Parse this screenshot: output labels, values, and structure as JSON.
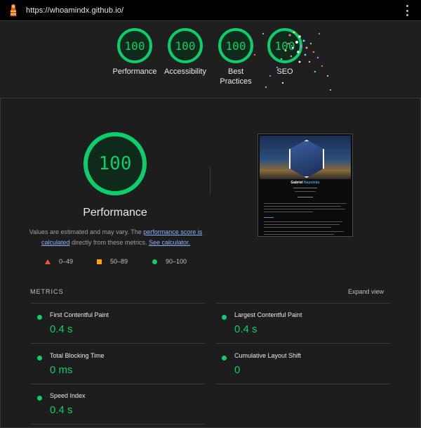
{
  "topbar": {
    "url": "https://whoamindx.github.io/",
    "logo_icon": "lighthouse-icon",
    "menu_icon": "kebab-menu-icon"
  },
  "summary": {
    "gauges": [
      {
        "label": "Performance",
        "score": "100"
      },
      {
        "label": "Accessibility",
        "score": "100"
      },
      {
        "label": "Best Practices",
        "score": "100"
      },
      {
        "label": "SEO",
        "score": "100"
      }
    ]
  },
  "performance": {
    "score": "100",
    "title": "Performance",
    "note_prefix": "Values are estimated and may vary. The ",
    "note_link1": "performance score is calculated",
    "note_middle": " directly from these metrics. ",
    "note_link2": "See calculator.",
    "legend": [
      {
        "range": "0–49",
        "icon": "fail-triangle-icon"
      },
      {
        "range": "50–89",
        "icon": "average-square-icon"
      },
      {
        "range": "90–100",
        "icon": "pass-circle-icon"
      }
    ]
  },
  "thumbnail": {
    "first_name": "Gabriel",
    "last_name": "Napoleão"
  },
  "metrics": {
    "title": "METRICS",
    "expand_label": "Expand view",
    "items": [
      {
        "label": "First Contentful Paint",
        "value": "0.4 s"
      },
      {
        "label": "Largest Contentful Paint",
        "value": "0.4 s"
      },
      {
        "label": "Total Blocking Time",
        "value": "0 ms"
      },
      {
        "label": "Cumulative Layout Shift",
        "value": "0"
      },
      {
        "label": "Speed Index",
        "value": "0.4 s"
      }
    ]
  },
  "colors": {
    "pass": "#0cce6b",
    "average": "#ffa400",
    "fail": "#ff4e42",
    "link": "#8ab4f8",
    "background": "#1d1d1d"
  }
}
